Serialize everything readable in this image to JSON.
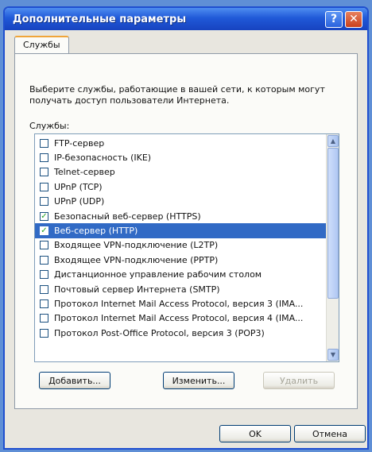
{
  "window": {
    "title": "Дополнительные параметры",
    "help_glyph": "?",
    "close_glyph": "✕"
  },
  "tabs": [
    {
      "label": "Службы"
    }
  ],
  "panel": {
    "description": "Выберите службы, работающие в вашей сети, к которым могут получать доступ пользователи Интернета.",
    "list_label": "Службы:"
  },
  "services": [
    {
      "label": "FTP-сервер",
      "checked": false,
      "selected": false
    },
    {
      "label": "IP-безопасность (IKE)",
      "checked": false,
      "selected": false
    },
    {
      "label": "Telnet-сервер",
      "checked": false,
      "selected": false
    },
    {
      "label": "UPnP (TCP)",
      "checked": false,
      "selected": false
    },
    {
      "label": "UPnP (UDP)",
      "checked": false,
      "selected": false
    },
    {
      "label": "Безопасный веб-сервер (HTTPS)",
      "checked": true,
      "selected": false
    },
    {
      "label": "Веб-сервер (HTTP)",
      "checked": true,
      "selected": true
    },
    {
      "label": "Входящее VPN-подключение (L2TP)",
      "checked": false,
      "selected": false
    },
    {
      "label": "Входящее VPN-подключение (PPTP)",
      "checked": false,
      "selected": false
    },
    {
      "label": "Дистанционное управление рабочим столом",
      "checked": false,
      "selected": false
    },
    {
      "label": "Почтовый сервер Интернета (SMTP)",
      "checked": false,
      "selected": false
    },
    {
      "label": "Протокол Internet Mail Access Protocol, версия 3 (IMA...",
      "checked": false,
      "selected": false
    },
    {
      "label": "Протокол Internet Mail Access Protocol, версия 4 (IMA...",
      "checked": false,
      "selected": false
    },
    {
      "label": "Протокол Post-Office Protocol, версия 3 (POP3)",
      "checked": false,
      "selected": false
    }
  ],
  "buttons": {
    "add": "Добавить...",
    "edit": "Изменить...",
    "delete": "Удалить",
    "ok": "OK",
    "cancel": "Отмена"
  },
  "colors": {
    "selection": "#316ac5",
    "titlebar": "#2059d8",
    "close": "#c9401c"
  }
}
